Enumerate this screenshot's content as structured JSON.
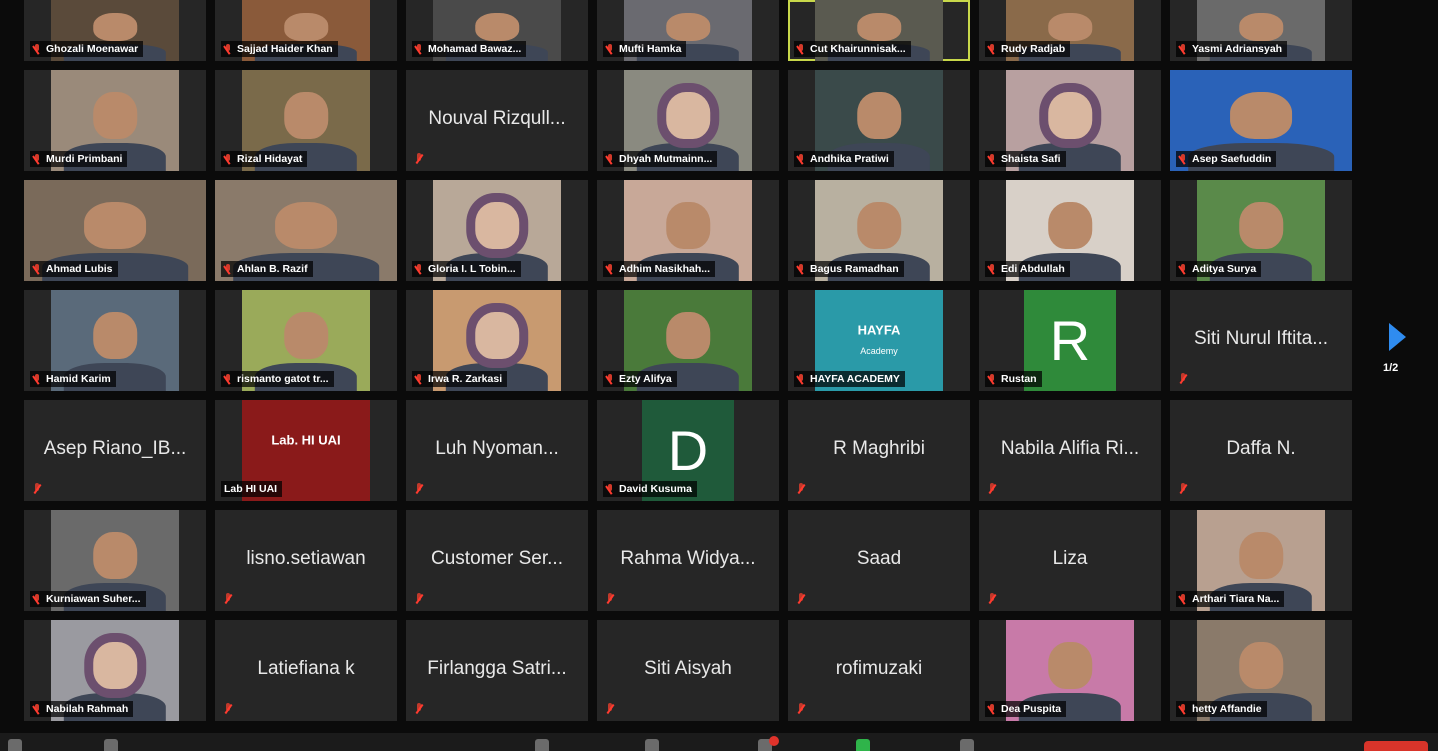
{
  "participants": [
    {
      "name": "Ghozali Moenawar",
      "bg": "#5a4a3a",
      "video": true
    },
    {
      "name": "Sajjad Haider Khan",
      "bg": "#8a5a3a",
      "video": true
    },
    {
      "name": "Mohamad Bawaz...",
      "bg": "#4a4a4a",
      "video": true
    },
    {
      "name": "Mufti Hamka",
      "bg": "#6a6a70",
      "video": true
    },
    {
      "name": "Cut Khairunnisak...",
      "bg": "#5a5a50",
      "video": true,
      "active": true
    },
    {
      "name": "Rudy Radjab",
      "bg": "#8a6a4a",
      "video": true
    },
    {
      "name": "Yasmi Adriansyah",
      "bg": "#6a6a6a",
      "video": true
    },
    {
      "name": "Murdi Primbani",
      "bg": "#9a8a7a",
      "video": true
    },
    {
      "name": "Rizal Hidayat",
      "bg": "#7a6a4a",
      "video": true
    },
    {
      "name": "Nouval Rizqull...",
      "video": false
    },
    {
      "name": "Dhyah Mutmainn...",
      "bg": "#8a8a80",
      "video": true,
      "hijab": true
    },
    {
      "name": "Andhika Pratiwi",
      "bg": "#3a4a4a",
      "video": true
    },
    {
      "name": "Shaista Safi",
      "bg": "#b8a0a0",
      "video": true,
      "hijab": true
    },
    {
      "name": "Asep Saefuddin",
      "bg": "#2a62b8",
      "video": true,
      "wide": true
    },
    {
      "name": "Ahmad Lubis",
      "bg": "#7a6a5a",
      "video": true,
      "wide": true
    },
    {
      "name": "Ahlan B. Razif",
      "bg": "#8a7a6a",
      "video": true,
      "wide": true
    },
    {
      "name": "Gloria I. L Tobin...",
      "bg": "#b8a898",
      "video": true,
      "hijab": true
    },
    {
      "name": "Adhim Nasikhah...",
      "bg": "#c8a898",
      "video": true
    },
    {
      "name": "Bagus Ramadhan",
      "bg": "#b8b0a0",
      "video": true
    },
    {
      "name": "Edi Abdullah",
      "bg": "#d8d0c8",
      "video": true
    },
    {
      "name": "Aditya Surya",
      "bg": "#5a8a4a",
      "video": true
    },
    {
      "name": "Hamid Karim",
      "bg": "#5a6a7a",
      "video": true
    },
    {
      "name": "rismanto gatot tr...",
      "bg": "#9aaa5a",
      "video": true
    },
    {
      "name": "Irwa R. Zarkasi",
      "bg": "#c89a70",
      "video": true,
      "hijab": true
    },
    {
      "name": "Ezty Alifya",
      "bg": "#4a7a3a",
      "video": true
    },
    {
      "name": "HAYFA ACADEMY",
      "bg": "#2a9aa8",
      "video": true,
      "logo": "HAYFA",
      "logo_sub": "Academy"
    },
    {
      "name": "Rustan",
      "avatar": "R",
      "avatar_bg": "#2f8a3a"
    },
    {
      "name": "Siti Nurul Iftita...",
      "video": false
    },
    {
      "name": "Asep Riano_IB...",
      "video": false
    },
    {
      "name": "Lab HI UAI",
      "bg": "#8a1a1a",
      "video": true,
      "logo": "Lab. HI UAI",
      "no_mic": true
    },
    {
      "name": "Luh Nyoman...",
      "video": false
    },
    {
      "name": "David Kusuma",
      "avatar": "D",
      "avatar_bg": "#1f5a3a"
    },
    {
      "name": "R Maghribi",
      "video": false
    },
    {
      "name": "Nabila Alifia Ri...",
      "video": false
    },
    {
      "name": "Daffa N.",
      "video": false
    },
    {
      "name": "Kurniawan Suher...",
      "bg": "#6a6a6a",
      "video": true
    },
    {
      "name": "lisno.setiawan",
      "video": false
    },
    {
      "name": "Customer Ser...",
      "video": false
    },
    {
      "name": "Rahma Widya...",
      "video": false
    },
    {
      "name": "Saad",
      "video": false
    },
    {
      "name": "Liza",
      "video": false
    },
    {
      "name": "Arthari Tiara Na...",
      "bg": "#b8a090",
      "video": true
    },
    {
      "name": "Nabilah Rahmah",
      "bg": "#9a9aa0",
      "video": true,
      "hijab": true
    },
    {
      "name": "Latiefiana k",
      "video": false
    },
    {
      "name": "Firlangga Satri...",
      "video": false
    },
    {
      "name": "Siti Aisyah",
      "video": false
    },
    {
      "name": "rofimuzaki",
      "video": false
    },
    {
      "name": "Dea Puspita",
      "bg": "#c87aa8",
      "video": true
    },
    {
      "name": "hetty Affandie",
      "bg": "#8a7a6a",
      "video": true
    }
  ],
  "pager": {
    "indicator": "1/2"
  },
  "colors": {
    "accent": "#2f8cf0",
    "mic_muted": "#d23a2a",
    "active_border": "#c8d84a"
  }
}
